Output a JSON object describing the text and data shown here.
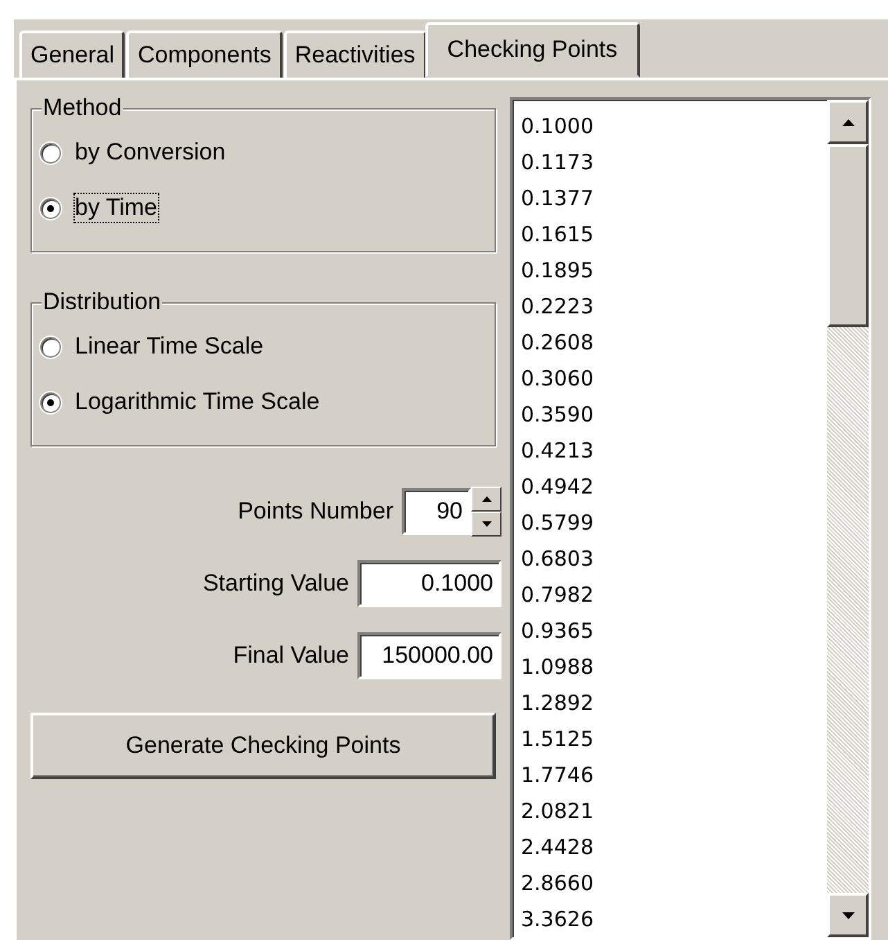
{
  "tabs": [
    {
      "label": "General",
      "selected": false
    },
    {
      "label": "Components",
      "selected": false
    },
    {
      "label": "Reactivities",
      "selected": false
    },
    {
      "label": "Checking Points",
      "selected": true
    }
  ],
  "method": {
    "title": "Method",
    "options": [
      {
        "label": "by Conversion",
        "selected": false
      },
      {
        "label": "by Time",
        "selected": true
      }
    ]
  },
  "distribution": {
    "title": "Distribution",
    "options": [
      {
        "label": "Linear Time Scale",
        "selected": false
      },
      {
        "label": "Logarithmic Time Scale",
        "selected": true
      }
    ]
  },
  "points_number": {
    "label": "Points Number",
    "value": "90"
  },
  "starting_value": {
    "label": "Starting Value",
    "value": "0.1000"
  },
  "final_value": {
    "label": "Final Value",
    "value": "150000.00"
  },
  "generate_button": "Generate Checking Points",
  "checking_points": [
    "0.1000",
    "0.1173",
    "0.1377",
    "0.1615",
    "0.1895",
    "0.2223",
    "0.2608",
    "0.3060",
    "0.3590",
    "0.4213",
    "0.4942",
    "0.5799",
    "0.6803",
    "0.7982",
    "0.9365",
    "1.0988",
    "1.2892",
    "1.5125",
    "1.7746",
    "2.0821",
    "2.4428",
    "2.8660",
    "3.3626"
  ]
}
